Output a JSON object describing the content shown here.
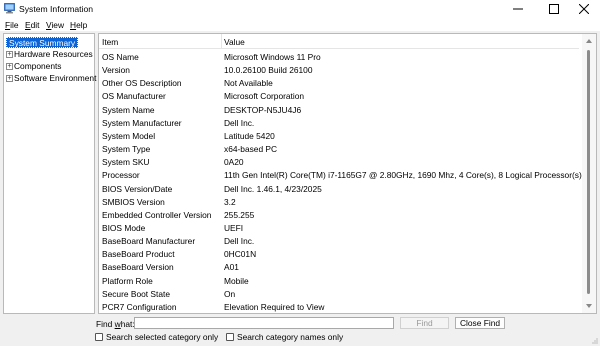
{
  "window": {
    "title": "System Information"
  },
  "menu": {
    "file": {
      "letter": "F",
      "rest": "ile"
    },
    "edit": {
      "letter": "E",
      "rest": "dit"
    },
    "view": {
      "letter": "V",
      "rest": "iew"
    },
    "help": {
      "letter": "H",
      "rest": "elp"
    }
  },
  "tree": {
    "selected": "System Summary",
    "items": [
      "Hardware Resources",
      "Components",
      "Software Environment"
    ]
  },
  "table": {
    "headers": {
      "item": "Item",
      "value": "Value"
    },
    "rows": [
      {
        "item": "OS Name",
        "value": "Microsoft Windows 11 Pro"
      },
      {
        "item": "Version",
        "value": "10.0.26100 Build 26100"
      },
      {
        "item": "Other OS Description",
        "value": "Not Available"
      },
      {
        "item": "OS Manufacturer",
        "value": "Microsoft Corporation"
      },
      {
        "item": "System Name",
        "value": "DESKTOP-N5JU4J6"
      },
      {
        "item": "System Manufacturer",
        "value": "Dell Inc."
      },
      {
        "item": "System Model",
        "value": "Latitude 5420"
      },
      {
        "item": "System Type",
        "value": "x64-based PC"
      },
      {
        "item": "System SKU",
        "value": "0A20"
      },
      {
        "item": "Processor",
        "value": "11th Gen Intel(R) Core(TM) i7-1165G7 @ 2.80GHz, 1690 Mhz, 4 Core(s), 8 Logical Processor(s)"
      },
      {
        "item": "BIOS Version/Date",
        "value": "Dell Inc. 1.46.1, 4/23/2025"
      },
      {
        "item": "SMBIOS Version",
        "value": "3.2"
      },
      {
        "item": "Embedded Controller Version",
        "value": "255.255"
      },
      {
        "item": "BIOS Mode",
        "value": "UEFI"
      },
      {
        "item": "BaseBoard Manufacturer",
        "value": "Dell Inc."
      },
      {
        "item": "BaseBoard Product",
        "value": "0HC01N"
      },
      {
        "item": "BaseBoard Version",
        "value": "A01"
      },
      {
        "item": "Platform Role",
        "value": "Mobile"
      },
      {
        "item": "Secure Boot State",
        "value": "On"
      },
      {
        "item": "PCR7 Configuration",
        "value": "Elevation Required to View"
      }
    ]
  },
  "find": {
    "label_letter": "w",
    "label_before": "Find ",
    "label_after": "hat:",
    "value": "",
    "find_button": "Find",
    "close_button": "Close Find",
    "check_selected": "Search selected category only",
    "check_names": "Search category names only"
  },
  "colors": {
    "selection": "#0a64d8",
    "panel_border": "#b9b9b9"
  }
}
